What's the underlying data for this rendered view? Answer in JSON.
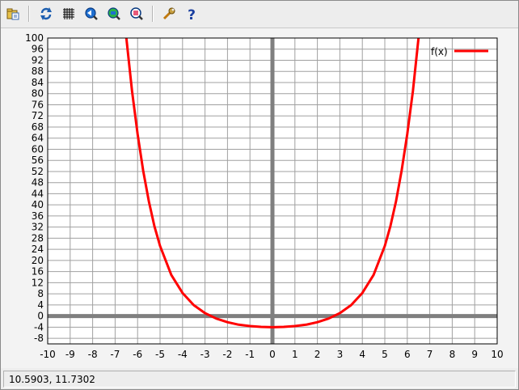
{
  "toolbar": {
    "buttons": [
      {
        "name": "open-icon"
      },
      {
        "name": "refresh-icon"
      },
      {
        "name": "grid-icon"
      },
      {
        "name": "zoom-back-icon"
      },
      {
        "name": "zoom-in-icon"
      },
      {
        "name": "zoom-fit-icon"
      },
      {
        "name": "settings-wrench-icon"
      },
      {
        "name": "help-icon"
      }
    ]
  },
  "status": {
    "coords": "10.5903,  11.7302"
  },
  "colors": {
    "curve": "#ff0000",
    "axis": "#7f7f7f",
    "grid": "#a0a0a0",
    "plot_bg": "#ffffff"
  },
  "chart_data": {
    "type": "line",
    "function": "f(x)",
    "xlim": [
      -10,
      10
    ],
    "ylim": [
      -10,
      100
    ],
    "x_ticks": [
      -10,
      -9,
      -8,
      -7,
      -6,
      -5,
      -4,
      -3,
      -2,
      -1,
      0,
      1,
      2,
      3,
      4,
      5,
      6,
      7,
      8,
      9,
      10
    ],
    "y_ticks": [
      -8,
      -4,
      0,
      4,
      8,
      12,
      16,
      20,
      24,
      28,
      32,
      36,
      40,
      44,
      48,
      52,
      56,
      60,
      64,
      68,
      72,
      76,
      80,
      84,
      88,
      92,
      96,
      100
    ],
    "grid": true,
    "legend": "top-right",
    "series": [
      {
        "name": "f(x)",
        "x": [
          -6.5,
          -6.25,
          -6,
          -5.75,
          -5.5,
          -5.25,
          -5,
          -4.5,
          -4,
          -3.5,
          -3,
          -2.5,
          -2,
          -1.5,
          -1,
          -0.5,
          0,
          0.5,
          1,
          1.5,
          2,
          2.5,
          3,
          3.5,
          4,
          4.5,
          5,
          5.25,
          5.5,
          5.75,
          6,
          6.25,
          6.5
        ],
        "y": [
          100,
          81,
          65.5,
          52.3,
          41.3,
          32.3,
          25.2,
          14.8,
          8.3,
          3.95,
          1.05,
          -0.9,
          -2.2,
          -3.1,
          -3.6,
          -3.9,
          -4,
          -3.9,
          -3.6,
          -3.1,
          -2.2,
          -0.9,
          1.05,
          3.95,
          8.3,
          14.8,
          25.2,
          32.3,
          41.3,
          52.3,
          65.5,
          81,
          100
        ]
      }
    ]
  }
}
